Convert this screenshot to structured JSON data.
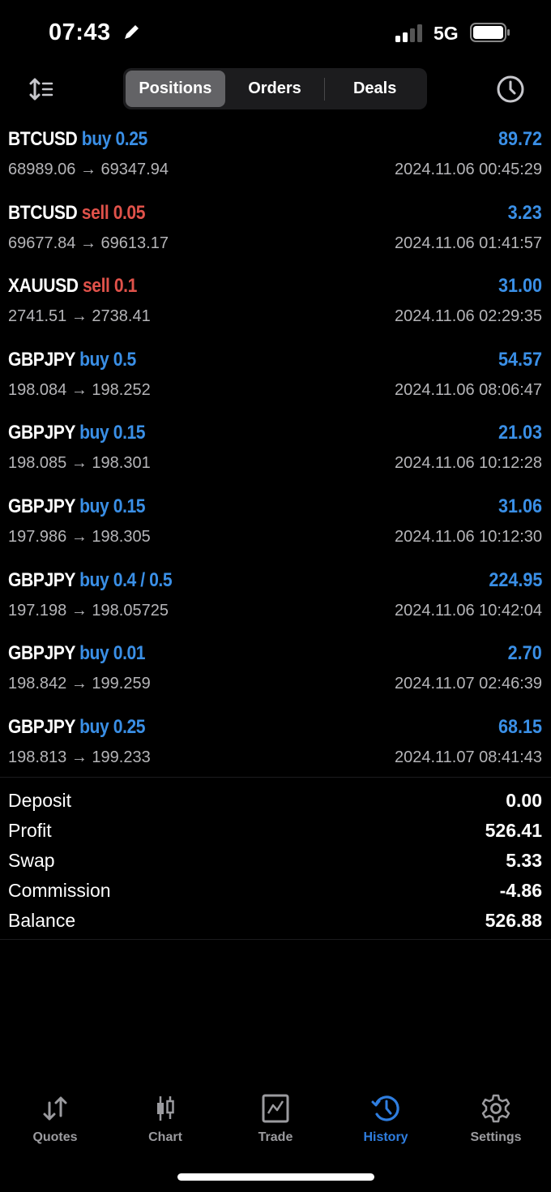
{
  "status_bar": {
    "time": "07:43",
    "network": "5G"
  },
  "toolbar": {
    "tabs": [
      {
        "label": "Positions",
        "active": true
      },
      {
        "label": "Orders",
        "active": false
      },
      {
        "label": "Deals",
        "active": false
      }
    ]
  },
  "deals": [
    {
      "symbol": "BTCUSD",
      "side": "buy",
      "volume": "0.25",
      "open_price": "68989.06",
      "close_price": "69347.94",
      "profit": "89.72",
      "time": "2024.11.06 00:45:29"
    },
    {
      "symbol": "BTCUSD",
      "side": "sell",
      "volume": "0.05",
      "open_price": "69677.84",
      "close_price": "69613.17",
      "profit": "3.23",
      "time": "2024.11.06 01:41:57"
    },
    {
      "symbol": "XAUUSD",
      "side": "sell",
      "volume": "0.1",
      "open_price": "2741.51",
      "close_price": "2738.41",
      "profit": "31.00",
      "time": "2024.11.06 02:29:35"
    },
    {
      "symbol": "GBPJPY",
      "side": "buy",
      "volume": "0.5",
      "open_price": "198.084",
      "close_price": "198.252",
      "profit": "54.57",
      "time": "2024.11.06 08:06:47"
    },
    {
      "symbol": "GBPJPY",
      "side": "buy",
      "volume": "0.15",
      "open_price": "198.085",
      "close_price": "198.301",
      "profit": "21.03",
      "time": "2024.11.06 10:12:28"
    },
    {
      "symbol": "GBPJPY",
      "side": "buy",
      "volume": "0.15",
      "open_price": "197.986",
      "close_price": "198.305",
      "profit": "31.06",
      "time": "2024.11.06 10:12:30"
    },
    {
      "symbol": "GBPJPY",
      "side": "buy",
      "volume": "0.4 / 0.5",
      "open_price": "197.198",
      "close_price": "198.05725",
      "profit": "224.95",
      "time": "2024.11.06 10:42:04"
    },
    {
      "symbol": "GBPJPY",
      "side": "buy",
      "volume": "0.01",
      "open_price": "198.842",
      "close_price": "199.259",
      "profit": "2.70",
      "time": "2024.11.07 02:46:39"
    },
    {
      "symbol": "GBPJPY",
      "side": "buy",
      "volume": "0.25",
      "open_price": "198.813",
      "close_price": "199.233",
      "profit": "68.15",
      "time": "2024.11.07 08:41:43"
    }
  ],
  "summary": [
    {
      "label": "Deposit",
      "value": "0.00"
    },
    {
      "label": "Profit",
      "value": "526.41"
    },
    {
      "label": "Swap",
      "value": "5.33"
    },
    {
      "label": "Commission",
      "value": "-4.86"
    },
    {
      "label": "Balance",
      "value": "526.88"
    }
  ],
  "tabbar": [
    {
      "label": "Quotes",
      "icon": "quotes-icon",
      "active": false
    },
    {
      "label": "Chart",
      "icon": "chart-icon",
      "active": false
    },
    {
      "label": "Trade",
      "icon": "trade-icon",
      "active": false
    },
    {
      "label": "History",
      "icon": "history-icon",
      "active": true
    },
    {
      "label": "Settings",
      "icon": "settings-icon",
      "active": false
    }
  ],
  "colors": {
    "buy": "#3a8fe6",
    "sell": "#e0524a",
    "active_tab": "#2f7ee0"
  }
}
